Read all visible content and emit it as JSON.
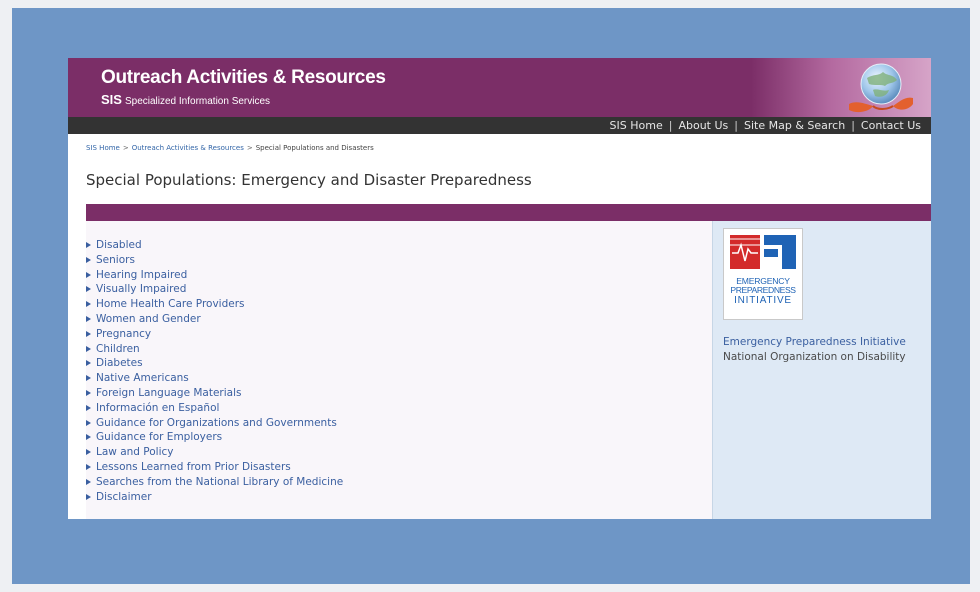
{
  "header": {
    "title": "Outreach Activities & Resources",
    "subtitle_abbr": "SIS",
    "subtitle": "Specialized Information Services"
  },
  "topnav": {
    "items": [
      "SIS Home",
      "About Us",
      "Site Map & Search",
      "Contact Us"
    ]
  },
  "breadcrumb": {
    "items": [
      "SIS Home",
      "Outreach Activities & Resources",
      "Special Populations and Disasters"
    ],
    "separator": ">"
  },
  "page": {
    "title": "Special Populations: Emergency and Disaster Preparedness"
  },
  "links": [
    "Disabled",
    "Seniors",
    "Hearing Impaired",
    "Visually Impaired",
    "Home Health Care Providers",
    "Women and Gender",
    "Pregnancy",
    "Children",
    "Diabetes",
    "Native Americans",
    "Foreign Language Materials",
    "Información en Español",
    "Guidance for Organizations and Governments",
    "Guidance for Employers",
    "Law and Policy",
    "Lessons Learned from Prior Disasters",
    "Searches from the National Library of Medicine",
    "Disclaimer"
  ],
  "sidebar": {
    "logo_text_1": "EMERGENCY",
    "logo_text_2": "PREPAREDNESS",
    "logo_text_3": "INITIATIVE",
    "link": "Emergency Preparedness Initiative",
    "org": "National Organization on Disability"
  },
  "colors": {
    "brand_purple": "#7b2e67",
    "nav_dark": "#333333",
    "link_blue": "#3a5fa0",
    "frame_blue": "#6e96c6",
    "sidebar_bg": "#dee9f5",
    "logo_red": "#d32b2b",
    "logo_blue": "#1f63b5"
  }
}
